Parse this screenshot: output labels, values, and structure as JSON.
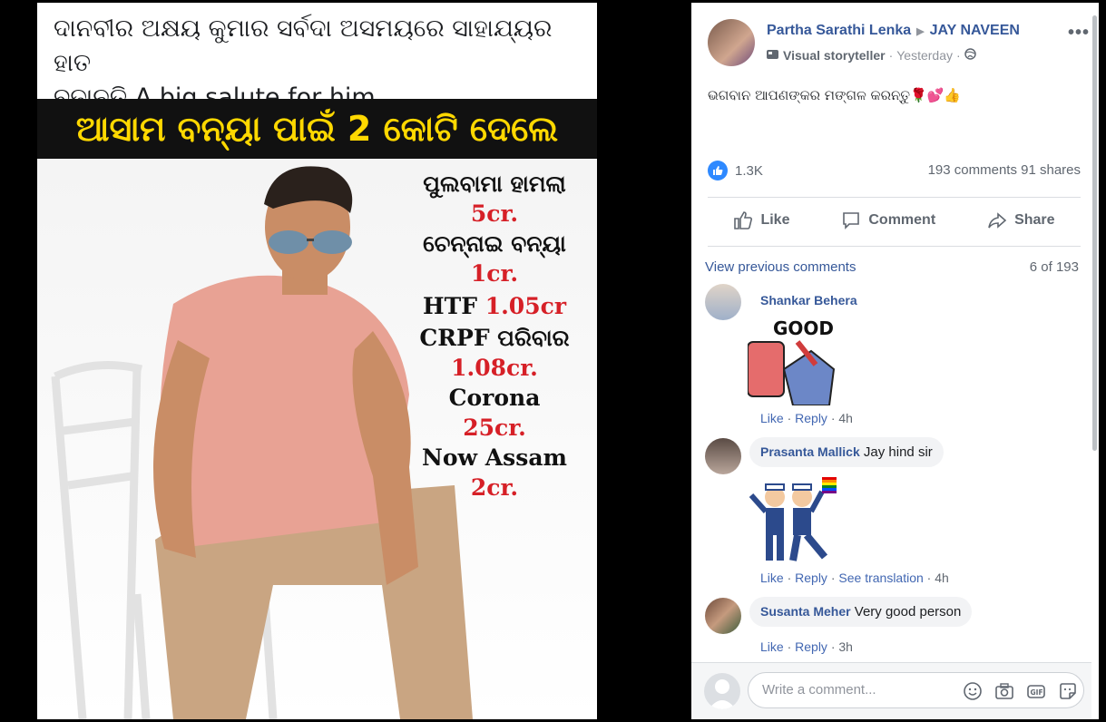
{
  "image": {
    "caption_line1": "ଦାନବୀର ଅକ୍ଷୟ କୁମାର ସର୍ବଦା ଅସମୟରେ ସାହାଯ୍ୟର ହାତ",
    "caption_line2": "ବଢାନ୍ତି A big salute for him",
    "banner": "ଆସାମ ବନ୍ୟା ପାଇଁ 2 କୋଟି ଦେଲେ",
    "stats": [
      {
        "label": "ପୁଲବାମା ହାମଲା",
        "value": "5cr."
      },
      {
        "label": "ଚେନ୍ନାଇ ବନ୍ୟା",
        "value": "1cr."
      },
      {
        "label": "HTF",
        "value": "1.05cr"
      },
      {
        "label": "CRPF ପରିବାର",
        "value": "1.08cr."
      },
      {
        "label": "Corona",
        "value": "25cr."
      },
      {
        "label": "Now Assam",
        "value": "2cr."
      }
    ]
  },
  "post": {
    "author": "Partha Sarathi Lenka",
    "page": "JAY NAVEEN",
    "badge": "Visual storyteller",
    "time": "Yesterday",
    "text": "ଭଗବାନ ଆପଣଙ୍କର ମଙ୍ଗଳ କରନ୍ତୁ🌹💕👍",
    "likes": "1.3K",
    "comments_shares": "193 comments  91 shares",
    "actions": {
      "like": "Like",
      "comment": "Comment",
      "share": "Share"
    }
  },
  "comments_section": {
    "view_previous": "View previous comments",
    "pager": "6 of 193",
    "items": [
      {
        "name": "Shankar Behera",
        "text": "",
        "sticker": "good-thumb-sticker",
        "actions": [
          "Like",
          "Reply"
        ],
        "time": "4h"
      },
      {
        "name": "Prasanta Mallick",
        "text": "Jay hind sir",
        "sticker": "sailors-flag-sticker",
        "actions": [
          "Like",
          "Reply",
          "See translation"
        ],
        "time": "4h"
      },
      {
        "name": "Susanta Meher",
        "text": "Very good person",
        "actions": [
          "Like",
          "Reply"
        ],
        "time": "3h"
      }
    ],
    "sticker_text": "GOOD"
  },
  "composer": {
    "placeholder": "Write a comment..."
  },
  "colors": {
    "link": "#365899",
    "accent": "#4267b2",
    "banner_text": "#ffd800",
    "stat_red": "#d62027"
  }
}
